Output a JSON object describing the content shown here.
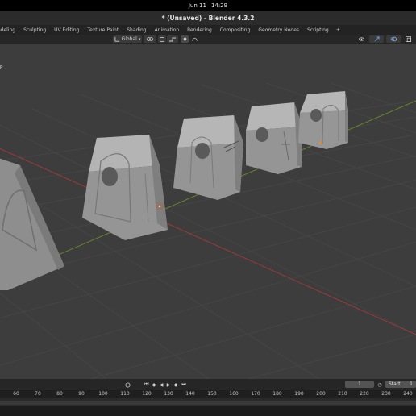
{
  "system": {
    "date": "Jun 11",
    "time": "14:29"
  },
  "window": {
    "title": "* (Unsaved) - Blender 4.3.2"
  },
  "workspaces": {
    "tabs": [
      {
        "label": "odeling"
      },
      {
        "label": "Sculpting"
      },
      {
        "label": "UV Editing"
      },
      {
        "label": "Texture Paint"
      },
      {
        "label": "Shading"
      },
      {
        "label": "Animation"
      },
      {
        "label": "Rendering"
      },
      {
        "label": "Compositing"
      },
      {
        "label": "Geometry Nodes"
      },
      {
        "label": "Scripting"
      }
    ],
    "add_label": "+"
  },
  "viewport_header": {
    "transform_orientation": "Global"
  },
  "viewport": {
    "overlay_label": "p"
  },
  "timeline": {
    "current_frame": "1",
    "start_label": "Start",
    "start_value": "1",
    "ruler_ticks": [
      "60",
      "70",
      "80",
      "90",
      "100",
      "110",
      "120",
      "130",
      "140",
      "150",
      "160",
      "170",
      "180",
      "190",
      "200",
      "210",
      "220",
      "230",
      "240"
    ]
  },
  "colors": {
    "viewport_bg": "#3d3d3d",
    "grid": "#464646",
    "axis_x": "#9b3a3a",
    "axis_y": "#6a8a2a",
    "object": "#9a9a9a",
    "accent": "#4772b3"
  }
}
